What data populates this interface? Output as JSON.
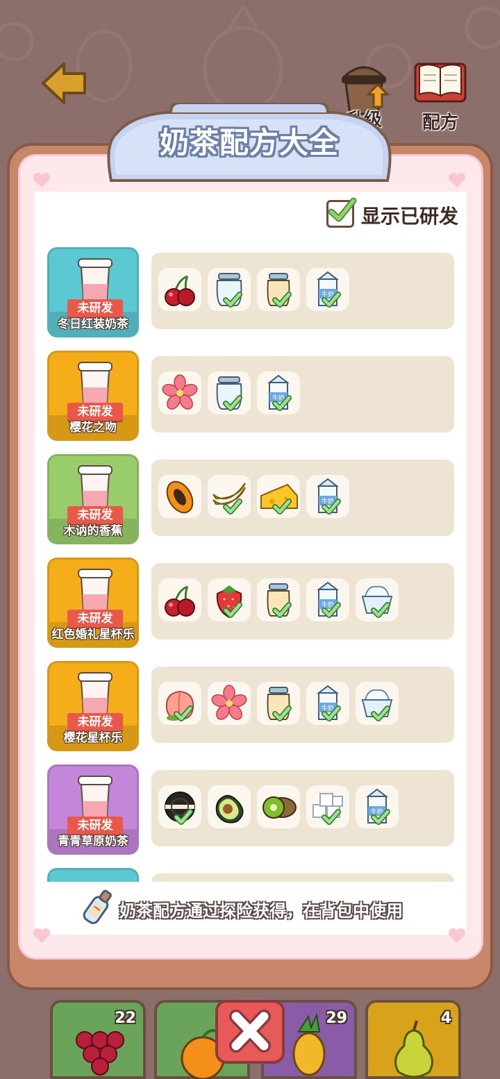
{
  "header": {
    "title": "奶茶配方大全",
    "upgrade_label": "升级",
    "recipe_label": "配方"
  },
  "filter": {
    "show_developed_label": "显示已研发",
    "checked": true
  },
  "recipes": [
    {
      "name": "冬日红装奶茶",
      "status": "未研发",
      "card_color": "#5cc8d2",
      "ingredients": [
        {
          "icon": "cherry-icon",
          "owned": false
        },
        {
          "icon": "empty-jar-icon",
          "owned": true
        },
        {
          "icon": "cream-jar-icon",
          "owned": true
        },
        {
          "icon": "milk-carton-icon",
          "owned": true
        }
      ]
    },
    {
      "name": "樱花之吻",
      "status": "未研发",
      "card_color": "#f5ad1a",
      "ingredients": [
        {
          "icon": "sakura-icon",
          "owned": false
        },
        {
          "icon": "empty-jar-icon",
          "owned": true
        },
        {
          "icon": "milk-carton-icon",
          "owned": true
        }
      ]
    },
    {
      "name": "木讷的香蕉",
      "status": "未研发",
      "card_color": "#99cd6c",
      "ingredients": [
        {
          "icon": "papaya-icon",
          "owned": false
        },
        {
          "icon": "banana-icon",
          "owned": true
        },
        {
          "icon": "cheese-icon",
          "owned": true
        },
        {
          "icon": "milk-carton-icon",
          "owned": true
        }
      ]
    },
    {
      "name": "红色婚礼星杯乐",
      "status": "未研发",
      "card_color": "#f5ad1a",
      "ingredients": [
        {
          "icon": "cherry-icon",
          "owned": false
        },
        {
          "icon": "strawberry-icon",
          "owned": true
        },
        {
          "icon": "cream-jar-icon",
          "owned": true
        },
        {
          "icon": "milk-carton-icon",
          "owned": true
        },
        {
          "icon": "ice-cream-cup-icon",
          "owned": true
        }
      ]
    },
    {
      "name": "樱花星杯乐",
      "status": "未研发",
      "card_color": "#f5ad1a",
      "ingredients": [
        {
          "icon": "peach-icon",
          "owned": true
        },
        {
          "icon": "sakura-icon",
          "owned": false
        },
        {
          "icon": "cream-jar-icon",
          "owned": true
        },
        {
          "icon": "milk-carton-icon",
          "owned": true
        },
        {
          "icon": "ice-cream-cup-icon",
          "owned": true
        }
      ]
    },
    {
      "name": "青青草原奶茶",
      "status": "未研发",
      "card_color": "#c486d8",
      "ingredients": [
        {
          "icon": "oreo-icon",
          "owned": true
        },
        {
          "icon": "avocado-icon",
          "owned": false
        },
        {
          "icon": "kiwi-icon",
          "owned": false
        },
        {
          "icon": "sugar-cubes-icon",
          "owned": true
        },
        {
          "icon": "milk-carton-icon",
          "owned": true
        }
      ]
    }
  ],
  "footer": {
    "note": "奶茶配方通过探险获得，在背包中使用"
  },
  "inventory": [
    {
      "item": "grape-icon",
      "count": "22",
      "color": "#6aa45a"
    },
    {
      "item": "orange-icon",
      "count": "",
      "color": "#6aa45a"
    },
    {
      "item": "pineapple-icon",
      "count": "29",
      "color": "#8a5ca8"
    },
    {
      "item": "pear-icon",
      "count": "4",
      "color": "#d8a21a"
    }
  ],
  "colors": {
    "background": "#8c6f6b",
    "panel": "#c8876a",
    "panel_pink": "#fde8ec",
    "title_banner": "#c6d3f0"
  }
}
